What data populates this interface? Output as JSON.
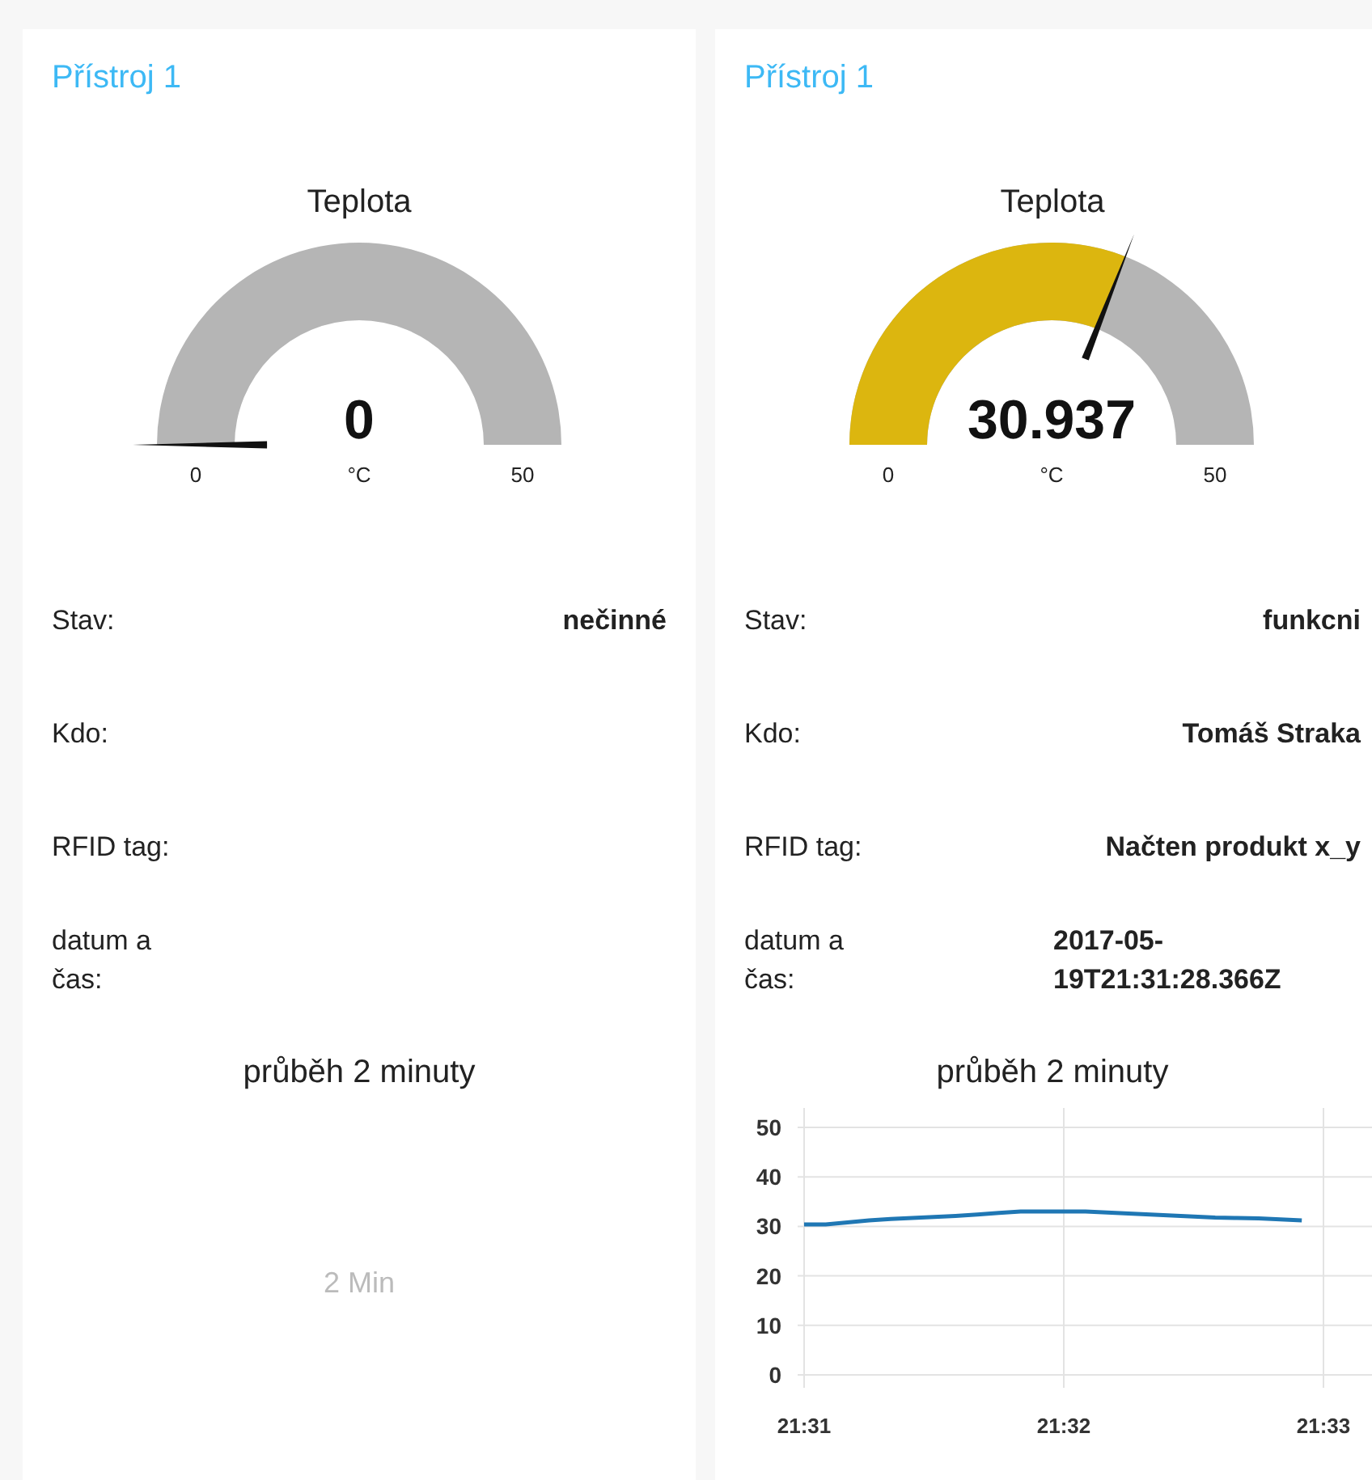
{
  "cards": [
    {
      "title": "Přístroj 1",
      "gauge": {
        "title": "Teplota",
        "value": "0",
        "units": "°C",
        "min": "0",
        "max": "50"
      },
      "rows": [
        {
          "label": "Stav:",
          "value": "nečinné"
        },
        {
          "label": "Kdo:"
        },
        {
          "label": "RFID tag:"
        },
        {
          "label": "datum a čas:"
        }
      ],
      "chart": {
        "title": "průběh 2 minuty",
        "empty_label": "2 Min"
      }
    },
    {
      "title": "Přístroj 1",
      "gauge": {
        "title": "Teplota",
        "value": "30.937",
        "units": "°C",
        "min": "0",
        "max": "50"
      },
      "rows": [
        {
          "label": "Stav:",
          "value": "funkcni"
        },
        {
          "label": "Kdo:",
          "value": "Tomáš Straka"
        },
        {
          "label": "RFID tag:",
          "value": "Načten produkt x_y"
        },
        {
          "label": "datum a čas:",
          "value": "2017-05-19T21:31:28.366Z"
        }
      ],
      "chart": {
        "title": "průběh 2 minuty",
        "chart_data": {
          "type": "line",
          "categories": [
            "21:31",
            null,
            null,
            null,
            null,
            null,
            null,
            null,
            null,
            null,
            null,
            null,
            "21:32",
            null,
            null,
            null,
            null,
            null,
            null,
            null,
            null,
            null,
            null,
            null,
            "21:33"
          ],
          "grid": true,
          "series": [
            {
              "color": "#1f77b4",
              "values": [
                30.4,
                30.4,
                30.8,
                31.2,
                31.5,
                31.7,
                31.9,
                32.1,
                32.4,
                32.7,
                33,
                33,
                33,
                33,
                32.8,
                32.6,
                32.4,
                32.2,
                32,
                31.8,
                31.7,
                31.6,
                31.4,
                31.2,
                null
              ]
            }
          ],
          "ylim": [
            0,
            50
          ],
          "yticks": [
            0,
            10,
            20,
            30,
            40,
            50
          ]
        }
      }
    }
  ]
}
